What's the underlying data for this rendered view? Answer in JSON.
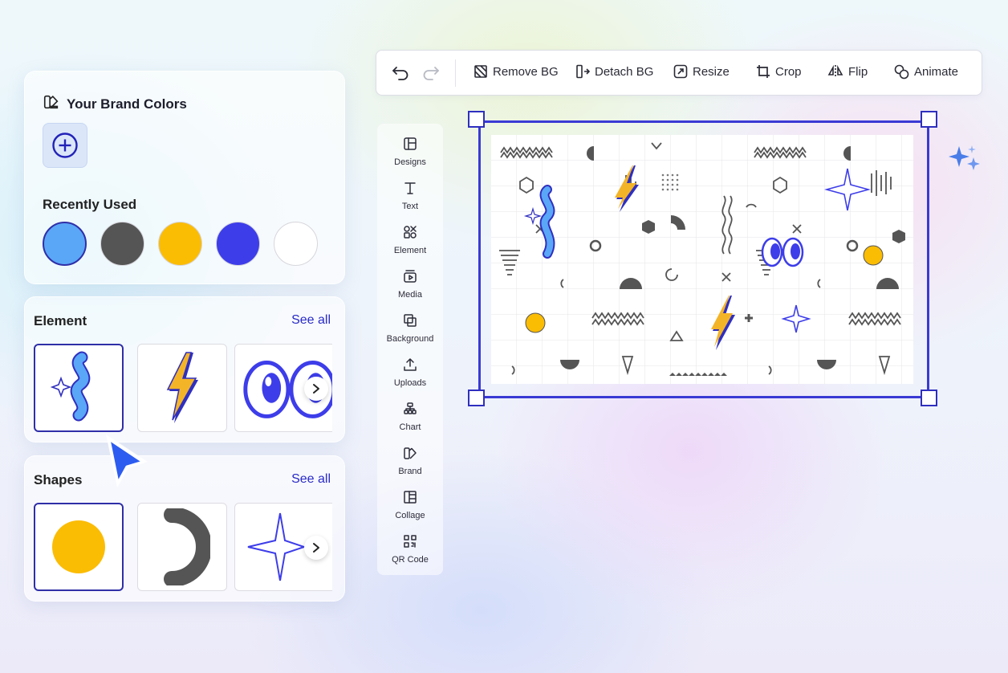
{
  "toolbar": {
    "undo_icon": "undo-icon",
    "redo_icon": "redo-icon",
    "remove_bg": "Remove BG",
    "detach_bg": "Detach BG",
    "resize": "Resize",
    "crop": "Crop",
    "flip": "Flip",
    "animate": "Animate"
  },
  "brand": {
    "title": "Your Brand Colors",
    "recent_title": "Recently Used",
    "recent_colors": [
      "#5aa6f7",
      "#555555",
      "#fbbc04",
      "#3d3dea",
      "#ffffff"
    ]
  },
  "element_panel": {
    "title": "Element",
    "see_all": "See all"
  },
  "shapes_panel": {
    "title": "Shapes",
    "see_all": "See all"
  },
  "sidebar": {
    "items": [
      {
        "label": "Designs",
        "icon": "layout-icon"
      },
      {
        "label": "Text",
        "icon": "text-icon"
      },
      {
        "label": "Element",
        "icon": "shapes-icon"
      },
      {
        "label": "Media",
        "icon": "media-icon"
      },
      {
        "label": "Background",
        "icon": "background-icon"
      },
      {
        "label": "Uploads",
        "icon": "upload-icon"
      },
      {
        "label": "Chart",
        "icon": "chart-icon"
      },
      {
        "label": "Brand",
        "icon": "brand-icon"
      },
      {
        "label": "Collage",
        "icon": "collage-icon"
      },
      {
        "label": "QR Code",
        "icon": "qr-code-icon"
      }
    ]
  },
  "colors": {
    "accent": "#3a3ad4",
    "link": "#2929c8",
    "yellow": "#fbbc04",
    "blue": "#5aa6f7",
    "gray": "#555555"
  }
}
